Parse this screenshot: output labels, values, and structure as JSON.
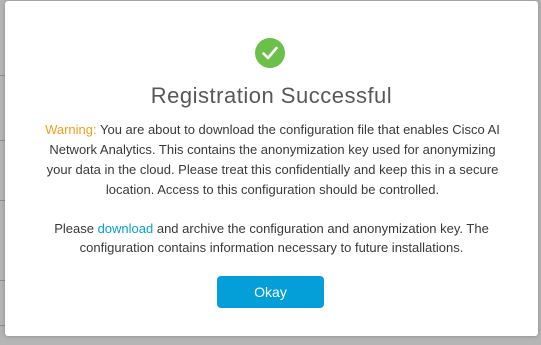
{
  "modal": {
    "icon": "checkmark-circle-icon",
    "icon_color": "#6cc04a",
    "title": "Registration Successful",
    "warning": {
      "label": "Warning:",
      "label_color": "#f49d1a",
      "text": "You are about to download the configuration file that enables Cisco AI Network Analytics. This contains the anonymization key used for anonymizing your data in the cloud. Please treat this confidentially and keep this in a secure location. Access to this configuration should be controlled."
    },
    "download": {
      "prefix": "Please",
      "link": "download",
      "suffix": "and archive the configuration and anonymization key. The configuration contains information necessary to future installations.",
      "link_color": "#049fd9"
    },
    "button": {
      "label": "Okay",
      "color": "#049fd9"
    }
  }
}
